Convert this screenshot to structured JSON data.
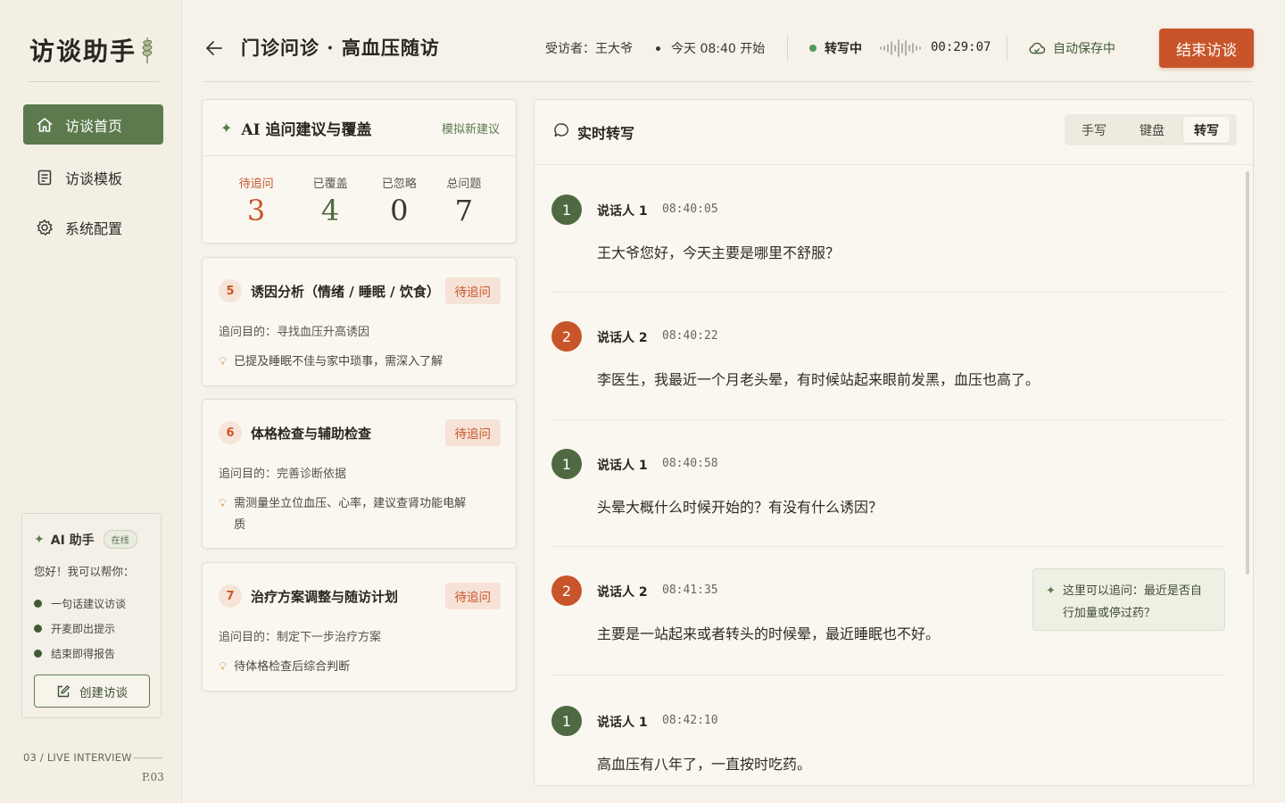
{
  "brand": "访谈助手",
  "nav": [
    {
      "label": "访谈首页",
      "icon": "home-icon"
    },
    {
      "label": "访谈模板",
      "icon": "template-icon"
    },
    {
      "label": "系统配置",
      "icon": "gear-icon"
    }
  ],
  "assistant": {
    "title": "AI 助手",
    "status": "在线",
    "greeting": "您好！我可以帮你：",
    "items": [
      "一句话建议访谈",
      "开麦即出提示",
      "结束即得报告"
    ],
    "create_label": "创建访谈"
  },
  "footer": {
    "label": "03 / LIVE INTERVIEW",
    "page": "P.03"
  },
  "header": {
    "title": "门诊问诊 · 高血压随访",
    "interviewee": "受访者：王大爷",
    "start": "今天 08:40 开始",
    "rec_status": "转写中",
    "timer": "00:29:07",
    "save_status": "自动保存中",
    "end_label": "结束访谈"
  },
  "colors": {
    "accent_green": "#5c7a4d",
    "accent_orange": "#c8552a",
    "background": "#f6f2e9"
  },
  "ai_panel": {
    "title": "AI 追问建议与覆盖",
    "simulate": "模拟新建议",
    "stats": [
      {
        "label": "待追问",
        "value": "3"
      },
      {
        "label": "已覆盖",
        "value": "4"
      },
      {
        "label": "已忽略",
        "value": "0"
      },
      {
        "label": "总问题",
        "value": "7"
      }
    ]
  },
  "questions": [
    {
      "num": "5",
      "title": "诱因分析（情绪 / 睡眠 / 饮食）",
      "status": "待追问",
      "purpose": "追问目的：寻找血压升高诱因",
      "hint": "已提及睡眠不佳与家中琐事，需深入了解"
    },
    {
      "num": "6",
      "title": "体格检查与辅助检查",
      "status": "待追问",
      "purpose": "追问目的：完善诊断依据",
      "hint": "需测量坐立位血压、心率，建议查肾功能电解质"
    },
    {
      "num": "7",
      "title": "治疗方案调整与随访计划",
      "status": "待追问",
      "purpose": "追问目的：制定下一步治疗方案",
      "hint": "待体格检查后综合判断"
    }
  ],
  "transcript": {
    "title": "实时转写",
    "modes": [
      "手写",
      "键盘",
      "转写"
    ],
    "active_mode": "转写",
    "messages": [
      {
        "avatar": "1",
        "speaker": "说话人 1",
        "time": "08:40:05",
        "text": "王大爷您好，今天主要是哪里不舒服？"
      },
      {
        "avatar": "2",
        "speaker": "说话人 2",
        "time": "08:40:22",
        "text": "李医生，我最近一个月老头晕，有时候站起来眼前发黑，血压也高了。"
      },
      {
        "avatar": "1",
        "speaker": "说话人 1",
        "time": "08:40:58",
        "text": "头晕大概什么时候开始的？有没有什么诱因？"
      },
      {
        "avatar": "2",
        "speaker": "说话人 2",
        "time": "08:41:35",
        "text": "主要是一站起来或者转头的时候晕，最近睡眠也不好。"
      },
      {
        "avatar": "1",
        "speaker": "说话人 1",
        "time": "08:42:10",
        "text": "高血压有八年了，一直按时吃药。"
      }
    ],
    "tip": "这里可以追问：最近是否自行加量或停过药？"
  }
}
